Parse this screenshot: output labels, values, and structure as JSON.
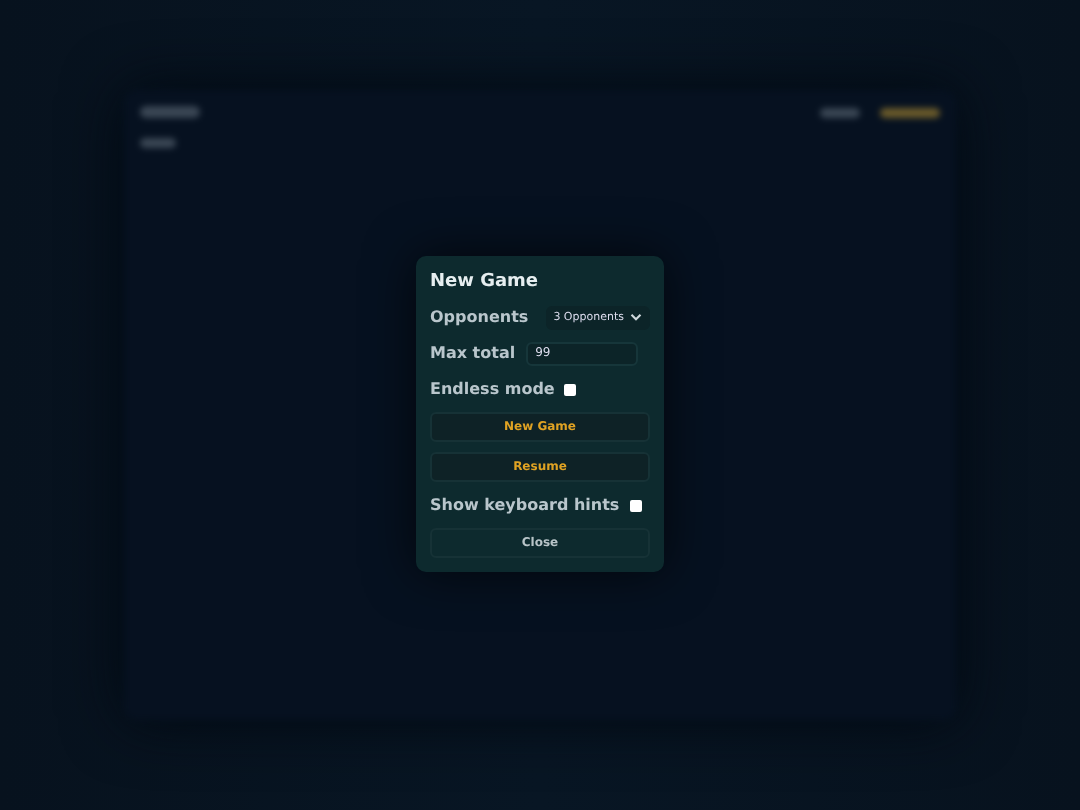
{
  "dialog": {
    "title": "New Game",
    "fields": [
      {
        "kind": "select",
        "label": "Opponents",
        "value": "3 Opponents"
      },
      {
        "kind": "number",
        "label": "Max total",
        "value": "99"
      },
      {
        "kind": "checkbox",
        "label": "Endless mode",
        "checked": false
      },
      {
        "kind": "button",
        "label": "New Game"
      },
      {
        "kind": "button",
        "label": "Resume"
      },
      {
        "kind": "checkbox",
        "label": "Show keyboard hints",
        "checked": false
      },
      {
        "kind": "close",
        "label": "Close"
      }
    ]
  }
}
